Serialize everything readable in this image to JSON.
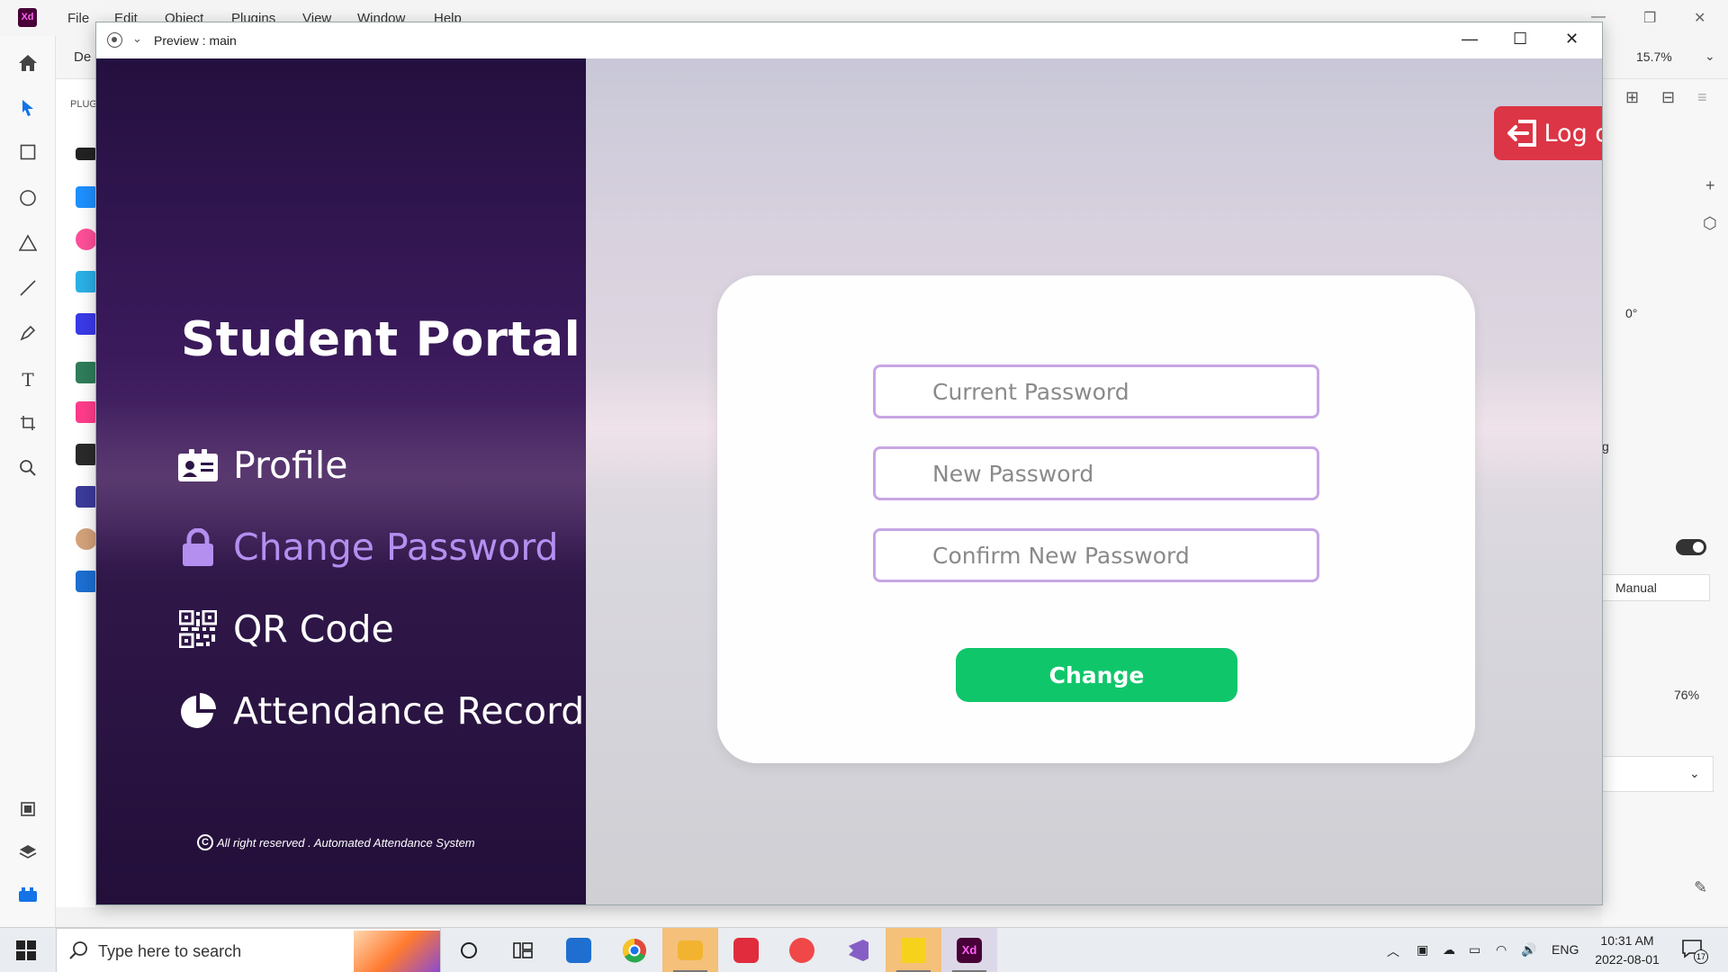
{
  "xd": {
    "logo": "Xd",
    "menu": [
      "File",
      "Edit",
      "Object",
      "Plugins",
      "View",
      "Window",
      "Help"
    ],
    "tab_partial": "De",
    "plugins_label": "PLUG",
    "zoom": "15.7%",
    "rotation": "0°",
    "partial_g": "g",
    "manual": "Manual",
    "percent": "76%"
  },
  "preview": {
    "title": "Preview : main"
  },
  "sidebar": {
    "brand": "Student Portal",
    "items": [
      {
        "label": "Profile",
        "icon": "id-card-icon"
      },
      {
        "label": "Change Password",
        "icon": "lock-icon"
      },
      {
        "label": "QR Code",
        "icon": "qr-code-icon"
      },
      {
        "label": "Attendance Record",
        "icon": "pie-chart-icon"
      }
    ],
    "active_index": 1,
    "footer": "All right reserved . Automated Attendance System"
  },
  "main": {
    "logout_label": "Log out",
    "current_password_placeholder": "Current Password",
    "new_password_placeholder": "New Password",
    "confirm_password_placeholder": "Confirm New Password",
    "change_label": "Change"
  },
  "colors": {
    "accent_purple": "#b48ff0",
    "logout_red": "#dc3545",
    "change_green": "#10c66b",
    "field_border": "#c7a6e3"
  },
  "taskbar": {
    "search_placeholder": "Type here to search",
    "language": "ENG",
    "time": "10:31 AM",
    "date": "2022-08-01",
    "notifications": "17"
  }
}
